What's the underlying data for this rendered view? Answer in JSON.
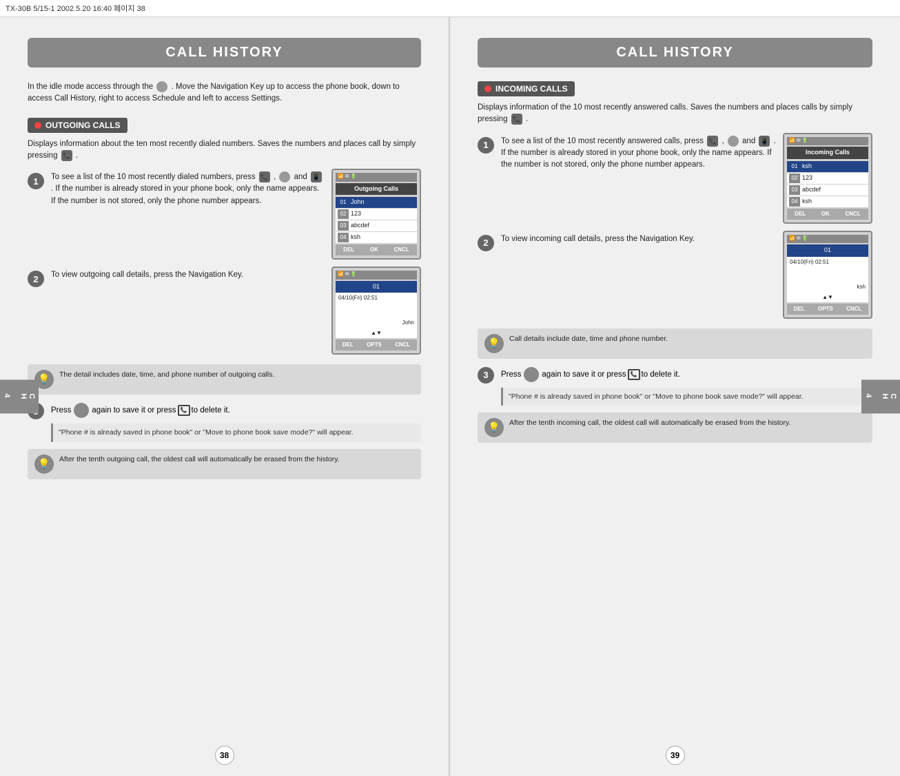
{
  "topbar": {
    "text": "TX-30B 5/15-1  2002.5.20 16:40 페이지 38"
  },
  "leftPage": {
    "title": "CALL HISTORY",
    "intro": "In the idle mode access through the   . Move the Navigation Key up to access the phone book, down to access Call History, right to access Schedule and left to access Settings.",
    "section": {
      "label": "OUTGOING CALLS",
      "desc": "Displays information about the ten most recently dialed numbers. Saves the numbers and places call by simply pressing    .",
      "step1": {
        "num": "1",
        "text": "To see a list of the 10 most recently dialed numbers, press",
        "text2": ",",
        "text3": "and",
        "text4": ". If the number is already stored in your phone book, only the name appears. If the number is not stored, only the phone number appears.",
        "screenTitle": "Outgoing Calls",
        "rows": [
          {
            "num": "01",
            "name": "John",
            "selected": true
          },
          {
            "num": "02",
            "name": "123"
          },
          {
            "num": "03",
            "name": "abcdef"
          },
          {
            "num": "04",
            "name": "ksh"
          }
        ],
        "buttons": [
          "DEL",
          "OK",
          "CNCL"
        ]
      },
      "step2": {
        "num": "2",
        "text": "To view outgoing call details, press the Navigation Key.",
        "detailNum": "01",
        "detailDate": "04/10(Fri) 02:51",
        "detailName": "John",
        "buttons": [
          "DEL",
          "OPTS",
          "CNCL"
        ]
      },
      "tip1": {
        "text": "The detail includes date, time, and phone number of outgoing calls."
      },
      "step3": {
        "num": "3",
        "pressText": "Press",
        "midText": "again to save it or press",
        "endText": "to delete it."
      },
      "quote": "\"Phone # is already saved in phone book\" or \"Move to phone book save mode?\" will appear.",
      "tip2": {
        "text": "After the tenth outgoing call, the oldest call will automatically be erased from the history."
      }
    },
    "pageNumber": "38"
  },
  "rightPage": {
    "title": "CALL HISTORY",
    "section": {
      "label": "INCOMING CALLS",
      "desc": "Displays information of the 10 most recently answered calls. Saves the numbers and places calls by simply pressing    .",
      "step1": {
        "num": "1",
        "text": "To see a list of the 10 most recently answered calls, press",
        "text2": ",",
        "text3": "and",
        "text4": ". If the number is already stored in your phone book, only the name appears. If the number is not stored, only the phone number appears.",
        "screenTitle": "Incoming Calls",
        "rows": [
          {
            "num": "01",
            "name": "ksh",
            "selected": true
          },
          {
            "num": "02",
            "name": "123"
          },
          {
            "num": "03",
            "name": "abcdef"
          },
          {
            "num": "04",
            "name": "ksh"
          }
        ],
        "buttons": [
          "DEL",
          "OK",
          "CNCL"
        ]
      },
      "step2": {
        "num": "2",
        "text": "To view incoming call details, press the Navigation Key.",
        "detailNum": "01",
        "detailDate": "04/10(Fri) 02:51",
        "detailName": "ksh",
        "buttons": [
          "DEL",
          "OPTS",
          "CNCL"
        ]
      },
      "tip1": {
        "text": "Call details include date, time and phone number."
      },
      "step3": {
        "num": "3",
        "pressText": "Press",
        "midText": "again to save it or press",
        "endText": "to delete it."
      },
      "quote": "\"Phone # is already saved in phone book\" or \"Move to phone book save mode?\" will appear.",
      "tip2": {
        "text": "After the tenth incoming call, the oldest call will automatically be erased from the history."
      }
    },
    "pageNumber": "39"
  }
}
